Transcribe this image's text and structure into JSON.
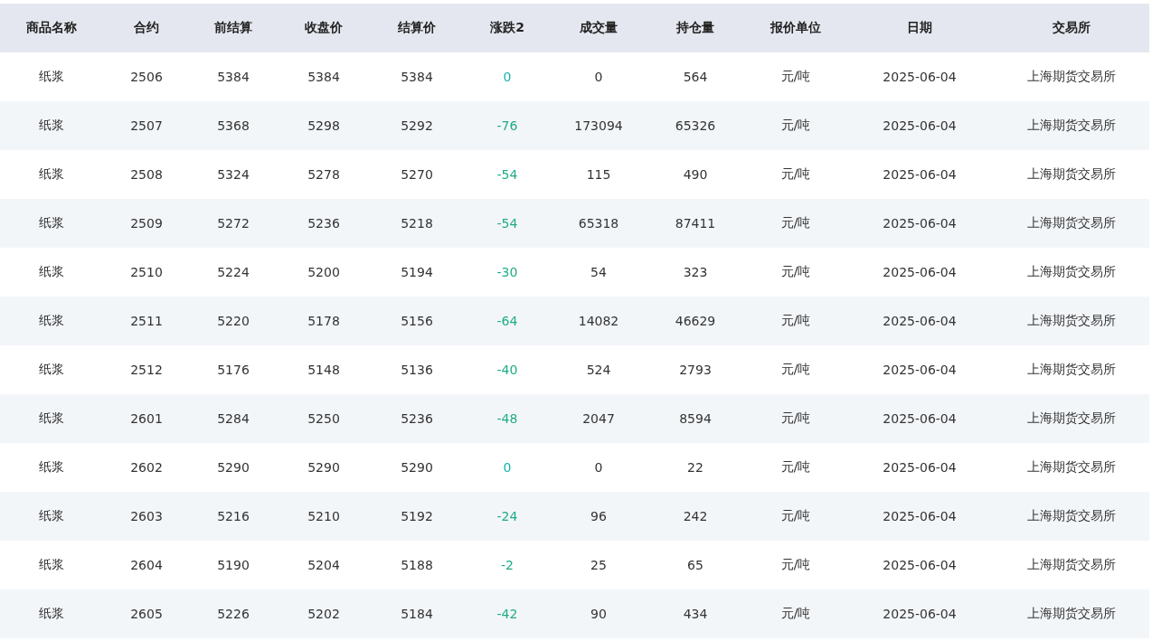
{
  "table": {
    "columns": [
      "商品名称",
      "合约",
      "前结算",
      "收盘价",
      "结算价",
      "涨跌2",
      "成交量",
      "持仓量",
      "报价单位",
      "日期",
      "交易所"
    ],
    "rows": [
      {
        "cells": [
          "纸浆",
          "2506",
          "5384",
          "5384",
          "5384",
          "0",
          "0",
          "564",
          "元/吨",
          "2025-06-04",
          "上海期货交易所"
        ],
        "color": "#14b3b0"
      },
      {
        "cells": [
          "纸浆",
          "2507",
          "5368",
          "5298",
          "5292",
          "-76",
          "173094",
          "65326",
          "元/吨",
          "2025-06-04",
          "上海期货交易所"
        ],
        "color": "#1fab87"
      },
      {
        "cells": [
          "纸浆",
          "2508",
          "5324",
          "5278",
          "5270",
          "-54",
          "115",
          "490",
          "元/吨",
          "2025-06-04",
          "上海期货交易所"
        ],
        "color": "#1fab87"
      },
      {
        "cells": [
          "纸浆",
          "2509",
          "5272",
          "5236",
          "5218",
          "-54",
          "65318",
          "87411",
          "元/吨",
          "2025-06-04",
          "上海期货交易所"
        ],
        "color": "#1fab87"
      },
      {
        "cells": [
          "纸浆",
          "2510",
          "5224",
          "5200",
          "5194",
          "-30",
          "54",
          "323",
          "元/吨",
          "2025-06-04",
          "上海期货交易所"
        ],
        "color": "#1fab87"
      },
      {
        "cells": [
          "纸浆",
          "2511",
          "5220",
          "5178",
          "5156",
          "-64",
          "14082",
          "46629",
          "元/吨",
          "2025-06-04",
          "上海期货交易所"
        ],
        "color": "#1fab87"
      },
      {
        "cells": [
          "纸浆",
          "2512",
          "5176",
          "5148",
          "5136",
          "-40",
          "524",
          "2793",
          "元/吨",
          "2025-06-04",
          "上海期货交易所"
        ],
        "color": "#1fab87"
      },
      {
        "cells": [
          "纸浆",
          "2601",
          "5284",
          "5250",
          "5236",
          "-48",
          "2047",
          "8594",
          "元/吨",
          "2025-06-04",
          "上海期货交易所"
        ],
        "color": "#1fab87"
      },
      {
        "cells": [
          "纸浆",
          "2602",
          "5290",
          "5290",
          "5290",
          "0",
          "0",
          "22",
          "元/吨",
          "2025-06-04",
          "上海期货交易所"
        ],
        "color": "#14b3b0"
      },
      {
        "cells": [
          "纸浆",
          "2603",
          "5216",
          "5210",
          "5192",
          "-24",
          "96",
          "242",
          "元/吨",
          "2025-06-04",
          "上海期货交易所"
        ],
        "color": "#1fab87"
      },
      {
        "cells": [
          "纸浆",
          "2604",
          "5190",
          "5204",
          "5188",
          "-2",
          "25",
          "65",
          "元/吨",
          "2025-06-04",
          "上海期货交易所"
        ],
        "color": "#1fab87"
      },
      {
        "cells": [
          "纸浆",
          "2605",
          "5226",
          "5202",
          "5184",
          "-42",
          "90",
          "434",
          "元/吨",
          "2025-06-04",
          "上海期货交易所"
        ],
        "color": "#1fab87"
      }
    ]
  }
}
